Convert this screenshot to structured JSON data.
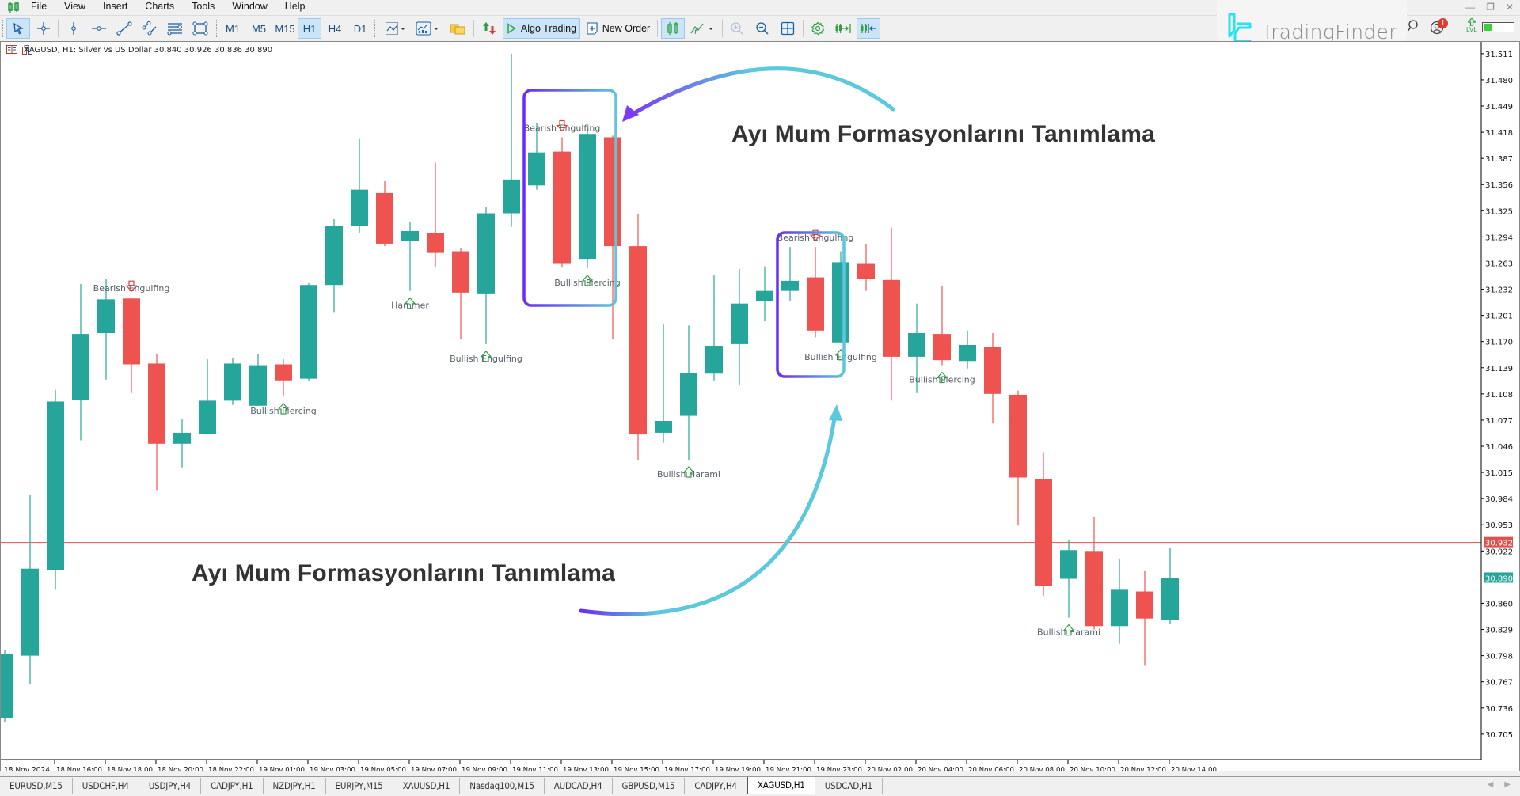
{
  "app": {
    "menu": [
      "File",
      "View",
      "Insert",
      "Charts",
      "Tools",
      "Window",
      "Help"
    ],
    "window_controls": [
      "minimize",
      "restore",
      "close"
    ]
  },
  "toolbar": {
    "timeframes": [
      "M1",
      "M5",
      "M15",
      "H1",
      "H4",
      "D1"
    ],
    "active_timeframe": "H1",
    "algo_trading_label": "Algo Trading",
    "new_order_label": "New Order",
    "notification_count": "1",
    "lvl_label": "LVL"
  },
  "watermark": {
    "brand": "TradingFinder"
  },
  "chart": {
    "symbol_line": "XAGUSD, H1:  Silver vs US Dollar  30.840 30.926 30.836 30.890",
    "colors": {
      "bull": "#26a69a",
      "bear": "#ef5350",
      "bid_line": "#d9534f",
      "ask_line": "#26a69a",
      "box_gradient_start": "#6a2cf5",
      "box_gradient_end": "#5bc8dc",
      "caption": "#333333"
    },
    "price_ticks": [
      "31.511",
      "31.480",
      "31.449",
      "31.418",
      "31.387",
      "31.356",
      "31.325",
      "31.294",
      "31.263",
      "31.232",
      "31.201",
      "31.170",
      "31.139",
      "31.108",
      "31.077",
      "31.046",
      "31.015",
      "30.984",
      "30.953",
      "30.922",
      "30.860",
      "30.829",
      "30.798",
      "30.767",
      "30.736",
      "30.705"
    ],
    "price_tick_values": [
      31.511,
      31.48,
      31.449,
      31.418,
      31.387,
      31.356,
      31.325,
      31.294,
      31.263,
      31.232,
      31.201,
      31.17,
      31.139,
      31.108,
      31.077,
      31.046,
      31.015,
      30.984,
      30.953,
      30.922,
      30.86,
      30.829,
      30.798,
      30.767,
      30.736,
      30.705
    ],
    "price_labels": [
      {
        "name": "red-price-label",
        "text": "30.932",
        "value": 30.932,
        "color": "#d9534f"
      },
      {
        "name": "green-price-label",
        "text": "30.890",
        "value": 30.89,
        "color": "#26a69a"
      }
    ],
    "time_labels": [
      "18 Nov 2024",
      "18 Nov 16:00",
      "18 Nov 18:00",
      "18 Nov 20:00",
      "18 Nov 22:00",
      "19 Nov 01:00",
      "19 Nov 03:00",
      "19 Nov 05:00",
      "19 Nov 07:00",
      "19 Nov 09:00",
      "19 Nov 11:00",
      "19 Nov 13:00",
      "19 Nov 15:00",
      "19 Nov 17:00",
      "19 Nov 19:00",
      "19 Nov 21:00",
      "19 Nov 23:00",
      "20 Nov 02:00",
      "20 Nov 04:00",
      "20 Nov 06:00",
      "20 Nov 08:00",
      "20 Nov 10:00",
      "20 Nov 12:00",
      "20 Nov 14:00"
    ],
    "captions": [
      "Ayı Mum Formasyonlarını Tanımlama",
      "Ayı Mum Formasyonlarını Tanımlama"
    ]
  },
  "chart_data": {
    "type": "candlestick",
    "symbol": "XAGUSD",
    "timeframe": "H1",
    "title": "XAGUSD, H1: Silver vs US Dollar",
    "ylim": [
      30.68,
      31.53
    ],
    "horizontal_lines": [
      30.932,
      30.89
    ],
    "candles": [
      {
        "o": 30.724,
        "h": 30.805,
        "l": 30.719,
        "c": 30.8
      },
      {
        "o": 30.798,
        "h": 30.988,
        "l": 30.764,
        "c": 30.901
      },
      {
        "o": 30.899,
        "h": 31.113,
        "l": 30.876,
        "c": 31.099
      },
      {
        "o": 31.101,
        "h": 31.238,
        "l": 31.053,
        "c": 31.179
      },
      {
        "o": 31.18,
        "h": 31.244,
        "l": 31.125,
        "c": 31.22
      },
      {
        "o": 31.221,
        "h": 31.222,
        "l": 31.109,
        "c": 31.143
      },
      {
        "o": 31.144,
        "h": 31.155,
        "l": 30.994,
        "c": 31.049
      },
      {
        "o": 31.049,
        "h": 31.078,
        "l": 31.021,
        "c": 31.062
      },
      {
        "o": 31.061,
        "h": 31.149,
        "l": 31.06,
        "c": 31.1
      },
      {
        "o": 31.1,
        "h": 31.15,
        "l": 31.095,
        "c": 31.144
      },
      {
        "o": 31.094,
        "h": 31.155,
        "l": 31.094,
        "c": 31.142
      },
      {
        "o": 31.143,
        "h": 31.149,
        "l": 31.105,
        "c": 31.124
      },
      {
        "o": 31.126,
        "h": 31.239,
        "l": 31.123,
        "c": 31.237
      },
      {
        "o": 31.237,
        "h": 31.315,
        "l": 31.205,
        "c": 31.307
      },
      {
        "o": 31.307,
        "h": 31.41,
        "l": 31.299,
        "c": 31.35
      },
      {
        "o": 31.346,
        "h": 31.36,
        "l": 31.283,
        "c": 31.286
      },
      {
        "o": 31.289,
        "h": 31.312,
        "l": 31.23,
        "c": 31.301
      },
      {
        "o": 31.299,
        "h": 31.382,
        "l": 31.258,
        "c": 31.275
      },
      {
        "o": 31.277,
        "h": 31.281,
        "l": 31.173,
        "c": 31.228
      },
      {
        "o": 31.227,
        "h": 31.329,
        "l": 31.167,
        "c": 31.322
      },
      {
        "o": 31.322,
        "h": 31.511,
        "l": 31.306,
        "c": 31.362
      },
      {
        "o": 31.355,
        "h": 31.429,
        "l": 31.35,
        "c": 31.394
      },
      {
        "o": 31.395,
        "h": 31.412,
        "l": 31.258,
        "c": 31.262
      },
      {
        "o": 31.268,
        "h": 31.422,
        "l": 31.257,
        "c": 31.416
      },
      {
        "o": 31.412,
        "h": 31.414,
        "l": 31.173,
        "c": 31.283
      },
      {
        "o": 31.283,
        "h": 31.321,
        "l": 31.03,
        "c": 31.06
      },
      {
        "o": 31.062,
        "h": 31.191,
        "l": 31.05,
        "c": 31.076
      },
      {
        "o": 31.082,
        "h": 31.189,
        "l": 31.03,
        "c": 31.133
      },
      {
        "o": 31.132,
        "h": 31.249,
        "l": 31.124,
        "c": 31.165
      },
      {
        "o": 31.167,
        "h": 31.256,
        "l": 31.118,
        "c": 31.215
      },
      {
        "o": 31.218,
        "h": 31.259,
        "l": 31.194,
        "c": 31.23
      },
      {
        "o": 31.23,
        "h": 31.282,
        "l": 31.218,
        "c": 31.242
      },
      {
        "o": 31.246,
        "h": 31.282,
        "l": 31.175,
        "c": 31.183
      },
      {
        "o": 31.169,
        "h": 31.277,
        "l": 31.169,
        "c": 31.264
      },
      {
        "o": 31.262,
        "h": 31.285,
        "l": 31.23,
        "c": 31.244
      },
      {
        "o": 31.243,
        "h": 31.305,
        "l": 31.1,
        "c": 31.152
      },
      {
        "o": 31.152,
        "h": 31.215,
        "l": 31.109,
        "c": 31.18
      },
      {
        "o": 31.179,
        "h": 31.236,
        "l": 31.142,
        "c": 31.148
      },
      {
        "o": 31.147,
        "h": 31.183,
        "l": 31.138,
        "c": 31.166
      },
      {
        "o": 31.164,
        "h": 31.18,
        "l": 31.073,
        "c": 31.108
      },
      {
        "o": 31.107,
        "h": 31.112,
        "l": 30.952,
        "c": 31.009
      },
      {
        "o": 31.007,
        "h": 31.039,
        "l": 30.869,
        "c": 30.881
      },
      {
        "o": 30.889,
        "h": 30.935,
        "l": 30.843,
        "c": 30.923
      },
      {
        "o": 30.922,
        "h": 30.962,
        "l": 30.829,
        "c": 30.833
      },
      {
        "o": 30.833,
        "h": 30.913,
        "l": 30.812,
        "c": 30.876
      },
      {
        "o": 30.874,
        "h": 30.898,
        "l": 30.786,
        "c": 30.842
      },
      {
        "o": 30.84,
        "h": 30.926,
        "l": 30.836,
        "c": 30.89
      }
    ],
    "pattern_labels": [
      {
        "text": "Bearish Engulfing",
        "candle": 5,
        "position": "above",
        "signal": "bearish"
      },
      {
        "text": "Bullish Piercing",
        "candle": 11,
        "position": "below",
        "signal": "bullish"
      },
      {
        "text": "Hammer",
        "candle": 16,
        "position": "below",
        "signal": "bullish"
      },
      {
        "text": "Bullish Engulfing",
        "candle": 19,
        "position": "below",
        "signal": "bullish"
      },
      {
        "text": "Bearish Engulfing",
        "candle": 22,
        "position": "above",
        "signal": "bearish"
      },
      {
        "text": "Bullish Piercing",
        "candle": 23,
        "position": "below",
        "signal": "bullish"
      },
      {
        "text": "Bullish Harami",
        "candle": 27,
        "position": "below",
        "signal": "bullish"
      },
      {
        "text": "Bearish Engulfing",
        "candle": 32,
        "position": "above",
        "signal": "bearish"
      },
      {
        "text": "Bullish Engulfing",
        "candle": 33,
        "position": "below",
        "signal": "bullish"
      },
      {
        "text": "Bullish Piercing",
        "candle": 37,
        "position": "below",
        "signal": "bullish"
      },
      {
        "text": "Bullish Harami",
        "candle": 42,
        "position": "below",
        "signal": "bullish"
      }
    ],
    "highlight_boxes": [
      {
        "from_candle": 21,
        "to_candle": 24
      },
      {
        "from_candle": 31,
        "to_candle": 33
      }
    ]
  },
  "tabs": {
    "items": [
      "EURUSD,M15",
      "USDCHF,H4",
      "USDJPY,H4",
      "CADJPY,H1",
      "NZDJPY,H1",
      "EURJPY,M15",
      "XAUUSD,H1",
      "Nasdaq100,M15",
      "AUDCAD,H4",
      "GBPUSD,M15",
      "CADJPY,H4",
      "XAGUSD,H1",
      "USDCAD,H1"
    ],
    "active": "XAGUSD,H1"
  }
}
